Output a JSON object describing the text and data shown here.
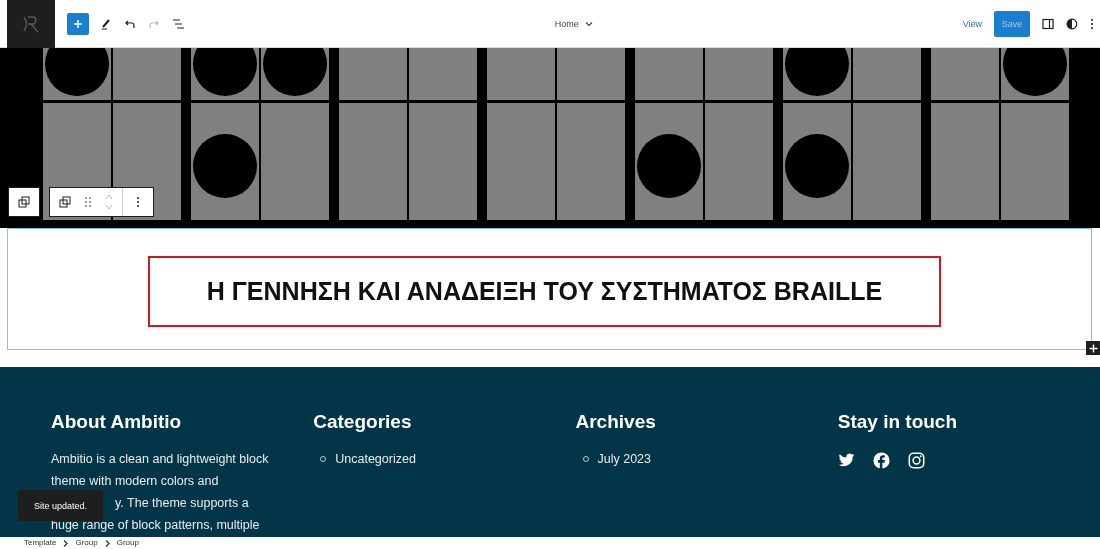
{
  "topbar": {
    "document_title": "Home",
    "view_label": "View",
    "save_label": "Save"
  },
  "heading": {
    "text": "Η ΓΕΝΝΗΣΗ ΚΑΙ ΑΝΑΔΕΙΞΗ ΤΟΥ ΣΥΣΤΗΜΑΤΟΣ BRAILLE",
    "selected": true
  },
  "footer": {
    "columns": [
      {
        "kind": "text",
        "title": "About Ambitio",
        "lines": [
          "Ambitio is a clean and lightweight block",
          "theme with modern colors and",
          "y. The theme supports a",
          "huge range of block patterns, multiple"
        ]
      },
      {
        "kind": "list",
        "title": "Categories",
        "items": [
          "Uncategorized"
        ]
      },
      {
        "kind": "list",
        "title": "Archives",
        "items": [
          "July 2023"
        ]
      },
      {
        "kind": "social",
        "title": "Stay in touch"
      }
    ]
  },
  "snackbar": {
    "text": "Site updated."
  },
  "breadcrumbs": [
    "Template",
    "Group",
    "Group"
  ]
}
